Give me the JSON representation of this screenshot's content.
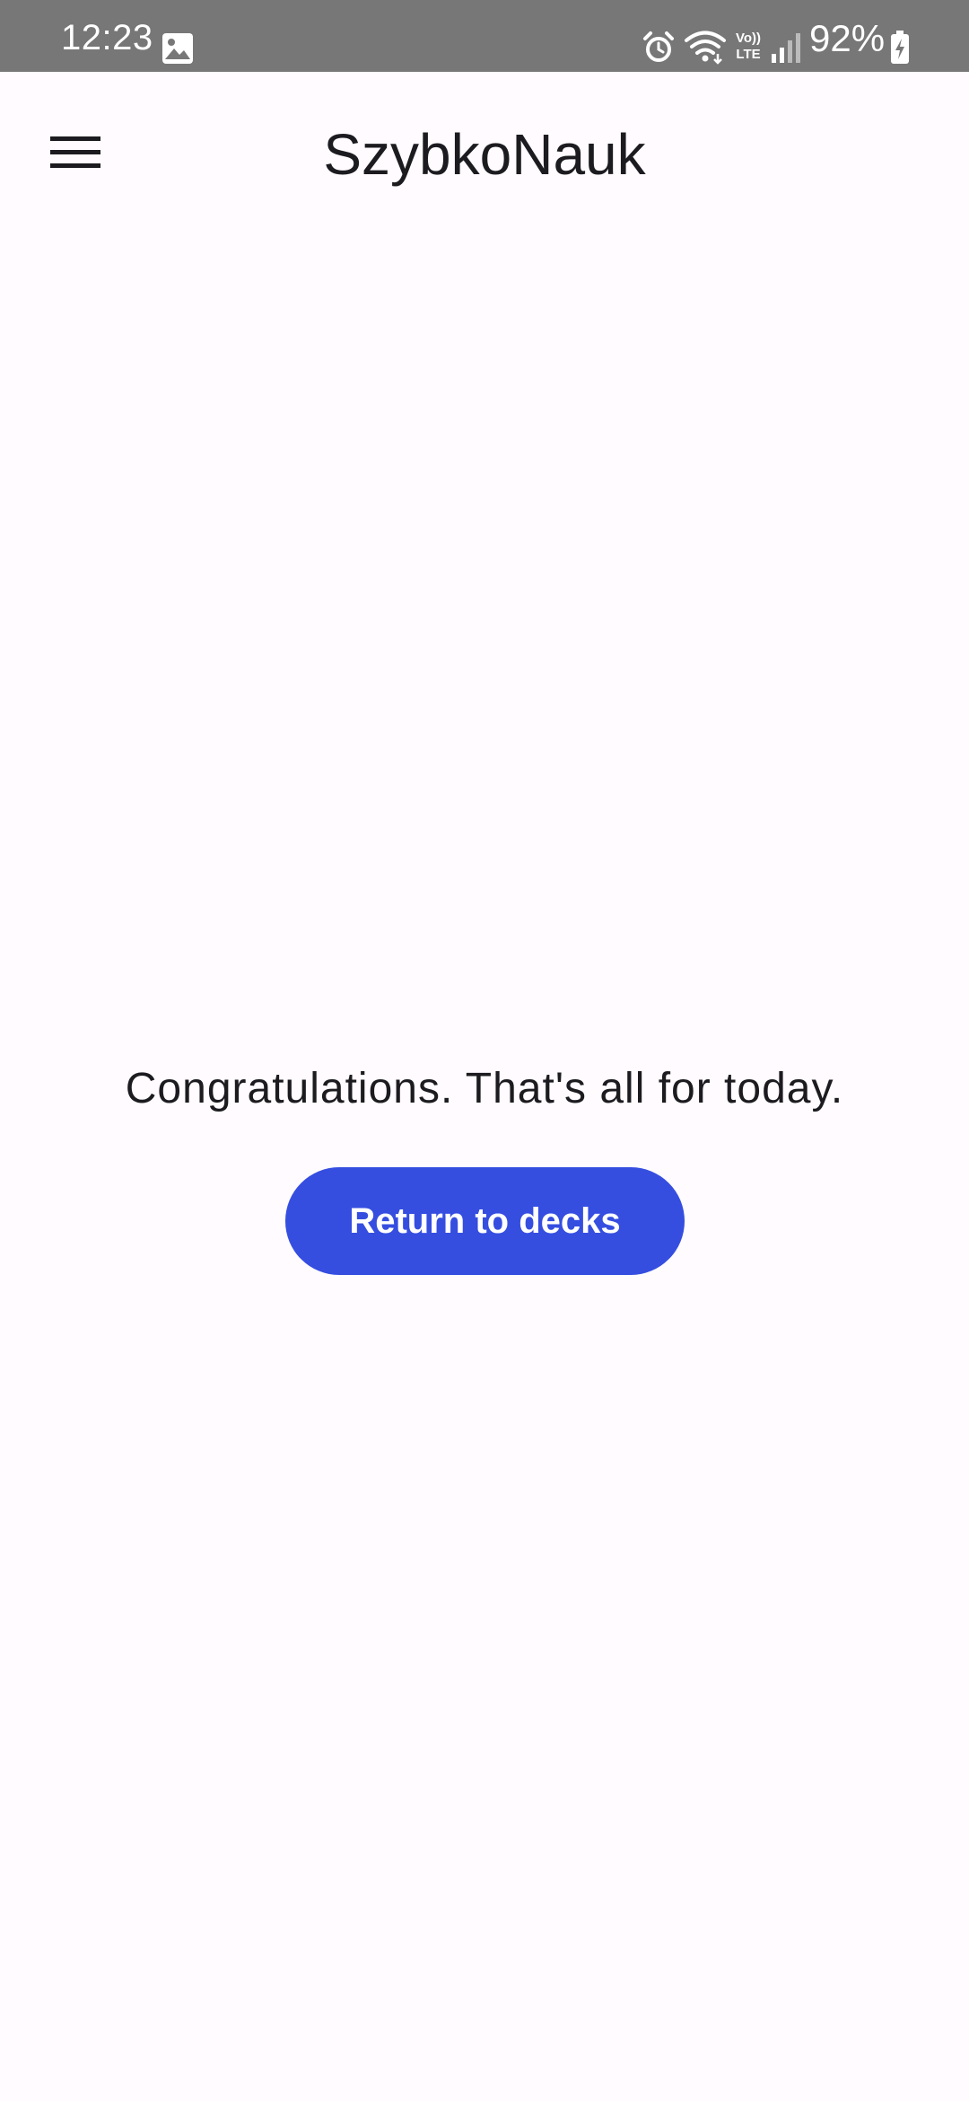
{
  "status_bar": {
    "time": "12:23",
    "battery": "92%",
    "icons": [
      "image-icon",
      "alarm-icon",
      "wifi-icon",
      "volte-icon",
      "signal-icon",
      "battery-charging-icon"
    ],
    "volte_top": "Vo))",
    "volte_bottom": "LTE"
  },
  "app_bar": {
    "title": "SzybkoNauk",
    "menu_icon": "hamburger-menu-icon"
  },
  "main": {
    "message": "Congratulations. That's all for today.",
    "return_button_label": "Return to decks"
  },
  "colors": {
    "status_bar_bg": "#777777",
    "background": "#fffbfe",
    "primary_button": "#354ee0",
    "text": "#1c1b1f"
  }
}
